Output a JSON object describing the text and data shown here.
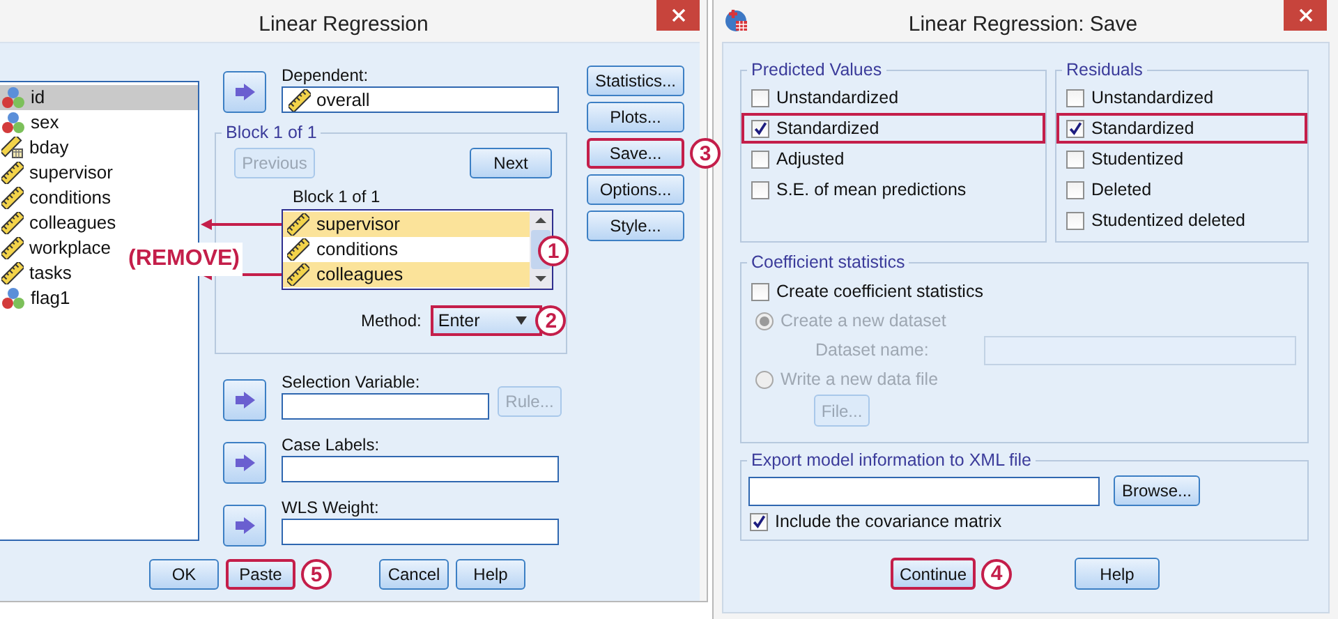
{
  "left_dialog": {
    "title": "Linear Regression",
    "variables": [
      {
        "name": "id",
        "kind": "nominal",
        "selected": true
      },
      {
        "name": "sex",
        "kind": "nominal",
        "selected": false
      },
      {
        "name": "bday",
        "kind": "date",
        "selected": false
      },
      {
        "name": "supervisor",
        "kind": "scale",
        "selected": false
      },
      {
        "name": "conditions",
        "kind": "scale",
        "selected": false
      },
      {
        "name": "colleagues",
        "kind": "scale",
        "selected": false
      },
      {
        "name": "workplace",
        "kind": "scale",
        "selected": false
      },
      {
        "name": "tasks",
        "kind": "scale",
        "selected": false
      },
      {
        "name": "flag1",
        "kind": "nominal",
        "selected": false
      }
    ],
    "dependent": {
      "label": "Dependent:",
      "value": "overall"
    },
    "block": {
      "legend": "Block 1 of 1",
      "previous": {
        "label": "Previous",
        "disabled": true
      },
      "next": {
        "label": "Next",
        "disabled": false
      },
      "list_label": "Block 1 of 1",
      "independents": [
        {
          "name": "supervisor",
          "selected": true
        },
        {
          "name": "conditions",
          "selected": false
        },
        {
          "name": "colleagues",
          "selected": true
        }
      ],
      "list_marker": "1",
      "method_label": "Method:",
      "method": "Enter",
      "method_marker": "2"
    },
    "remove_note": "(REMOVE)",
    "side_buttons": [
      {
        "label": "Statistics...",
        "highlighted": false
      },
      {
        "label": "Plots...",
        "highlighted": false
      },
      {
        "label": "Save...",
        "highlighted": true,
        "marker": "3"
      },
      {
        "label": "Options...",
        "highlighted": false
      },
      {
        "label": "Style...",
        "highlighted": false
      }
    ],
    "selection_variable": {
      "label": "Selection Variable:",
      "rule_button": {
        "label": "Rule...",
        "disabled": true
      }
    },
    "case_labels": {
      "label": "Case Labels:"
    },
    "wls_weight": {
      "label": "WLS Weight:"
    },
    "buttons": [
      {
        "label": "OK",
        "highlighted": false
      },
      {
        "label": "Paste",
        "highlighted": true,
        "marker": "5"
      },
      {
        "label": "Cancel",
        "highlighted": false
      },
      {
        "label": "Help",
        "highlighted": false
      }
    ]
  },
  "right_dialog": {
    "title": "Linear Regression: Save",
    "predicted_values": {
      "legend": "Predicted Values",
      "options": [
        {
          "label": "Unstandardized",
          "checked": false,
          "highlighted": false
        },
        {
          "label": "Standardized",
          "checked": true,
          "highlighted": true
        },
        {
          "label": "Adjusted",
          "checked": false,
          "highlighted": false
        },
        {
          "label": "S.E. of mean predictions",
          "checked": false,
          "highlighted": false
        }
      ]
    },
    "residuals": {
      "legend": "Residuals",
      "options": [
        {
          "label": "Unstandardized",
          "checked": false,
          "highlighted": false
        },
        {
          "label": "Standardized",
          "checked": true,
          "highlighted": true
        },
        {
          "label": "Studentized",
          "checked": false,
          "highlighted": false
        },
        {
          "label": "Deleted",
          "checked": false,
          "highlighted": false
        },
        {
          "label": "Studentized deleted",
          "checked": false,
          "highlighted": false
        }
      ]
    },
    "coefficient_statistics": {
      "legend": "Coefficient statistics",
      "create": {
        "label": "Create coefficient statistics",
        "checked": false
      },
      "radios": [
        {
          "label": "Create a new dataset",
          "selected": true,
          "disabled": true
        },
        {
          "label": "Write a new data file",
          "selected": false,
          "disabled": true
        }
      ],
      "dataset_name_label": "Dataset name:",
      "file_button": {
        "label": "File...",
        "disabled": true
      }
    },
    "export": {
      "legend": "Export model information to XML file",
      "browse_button": "Browse...",
      "include": {
        "label": "Include the covariance matrix",
        "checked": true
      }
    },
    "buttons": [
      {
        "label": "Continue",
        "highlighted": true,
        "marker": "4"
      },
      {
        "label": "Help",
        "highlighted": false
      }
    ]
  }
}
